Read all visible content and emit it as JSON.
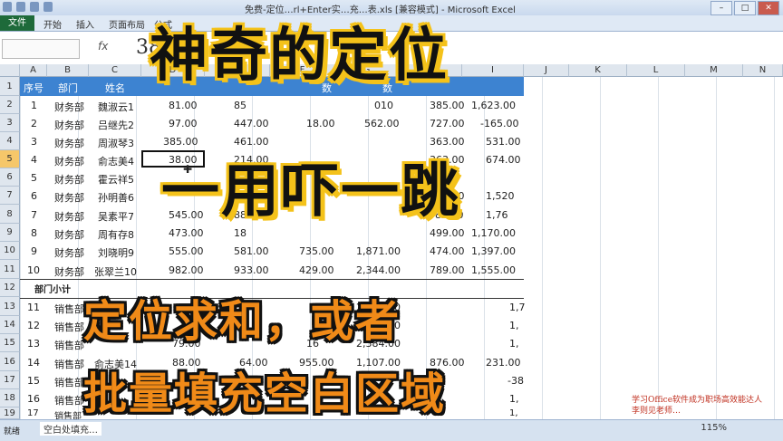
{
  "window": {
    "title": "免费-定位…rl+Enter实…充…表.xls [兼容模式] - Microsoft Excel"
  },
  "ribbon_tabs": [
    "文件",
    "开始",
    "插入",
    "页面布局",
    "公式"
  ],
  "formula_bar": {
    "fx_label": "fx",
    "value": "38"
  },
  "columns": [
    "A",
    "B",
    "C",
    "D",
    "E",
    "F",
    "G",
    "H",
    "I",
    "J",
    "K",
    "L",
    "M",
    "N"
  ],
  "header_row": [
    "序号",
    "部门",
    "姓名",
    "数",
    "数"
  ],
  "rows": [
    {
      "row": "2",
      "a": "1",
      "b": "财务部",
      "c": "魏淑云1",
      "d": "81.00",
      "e": "85",
      "f": "",
      "g": "010",
      "h": "385.00",
      "i": "1,623.00"
    },
    {
      "row": "3",
      "a": "2",
      "b": "财务部",
      "c": "吕继先2",
      "d": "97.00",
      "e": "447.00",
      "f": "18.00",
      "g": "562.00",
      "h": "727.00",
      "i": "-165.00"
    },
    {
      "row": "4",
      "a": "3",
      "b": "财务部",
      "c": "周淑琴3",
      "d": "385.00",
      "e": "461.00",
      "f": "",
      "g": "",
      "h": "363.00",
      "i": "531.00"
    },
    {
      "row": "5",
      "a": "4",
      "b": "财务部",
      "c": "俞志美4",
      "d": "38.00",
      "e": "214.00",
      "f": "",
      "g": "",
      "h": "363.00",
      "i": "674.00"
    },
    {
      "row": "6",
      "a": "5",
      "b": "财务部",
      "c": "霍云祥5",
      "d": "",
      "e": "",
      "f": "",
      "g": "",
      "h": "",
      "i": ""
    },
    {
      "row": "7",
      "a": "6",
      "b": "财务部",
      "c": "孙明善6",
      "d": "",
      "e": "",
      "f": "",
      "g": "",
      "h": "488.00",
      "i": "1,520"
    },
    {
      "row": "8",
      "a": "7",
      "b": "财务部",
      "c": "吴素平7",
      "d": "545.00",
      "e": "88",
      "f": "",
      "g": "",
      "h": "83.00",
      "i": "1,76"
    },
    {
      "row": "9",
      "a": "8",
      "b": "财务部",
      "c": "周有存8",
      "d": "473.00",
      "e": "18",
      "f": "",
      "g": "",
      "h": "499.00",
      "i": "1,170.00"
    },
    {
      "row": "10",
      "a": "9",
      "b": "财务部",
      "c": "刘晓明9",
      "d": "555.00",
      "e": "581.00",
      "f": "735.00",
      "g": "1,871.00",
      "h": "474.00",
      "i": "1,397.00"
    },
    {
      "row": "11",
      "a": "10",
      "b": "财务部",
      "c": "张翠兰10",
      "d": "982.00",
      "e": "933.00",
      "f": "429.00",
      "g": "2,344.00",
      "h": "789.00",
      "i": "1,555.00"
    }
  ],
  "subtotal_row": {
    "row": "12",
    "label": "部门小计"
  },
  "rows_lower": [
    {
      "row": "13",
      "a": "11",
      "b": "销售部",
      "g": "2,305.00",
      "i": "1,7"
    },
    {
      "row": "14",
      "a": "12",
      "b": "销售部",
      "g": "1,988.00",
      "i": "1,"
    },
    {
      "row": "15",
      "a": "13",
      "b": "销售部",
      "d": "79.00",
      "f": "16",
      "g": "2,384.00",
      "i": "1,"
    },
    {
      "row": "16",
      "a": "14",
      "b": "销售部",
      "c": "俞志美14",
      "d": "88.00",
      "e": "64.00",
      "f": "955.00",
      "g": "1,107.00",
      "h": "876.00",
      "i": "231.00"
    },
    {
      "row": "17",
      "a": "15",
      "b": "销售部",
      "i": "-38"
    },
    {
      "row": "18",
      "a": "16",
      "b": "销售部",
      "i": "1,"
    },
    {
      "row": "19",
      "a": "17",
      "b": "销售部",
      "i": "1,"
    }
  ],
  "active_cell": {
    "name": "D5",
    "cursor": "✚"
  },
  "sheet_tab": "空白处填充…",
  "status": {
    "ready": "就绪",
    "zoom": "115%"
  },
  "overlay": {
    "line1": "神奇的定位",
    "line2": "一用吓一跳",
    "line3": "定位求和，或者",
    "line4": "批量填充空白区域",
    "promo1": "学习Office软件成为职场高效能达人",
    "promo2": "李则见老师…"
  },
  "colors": {
    "header_blue": "#3d83d1",
    "overlay_yellow": "#f4c21a",
    "overlay_orange": "#f08a18",
    "file_tab": "#1e6a3a"
  }
}
